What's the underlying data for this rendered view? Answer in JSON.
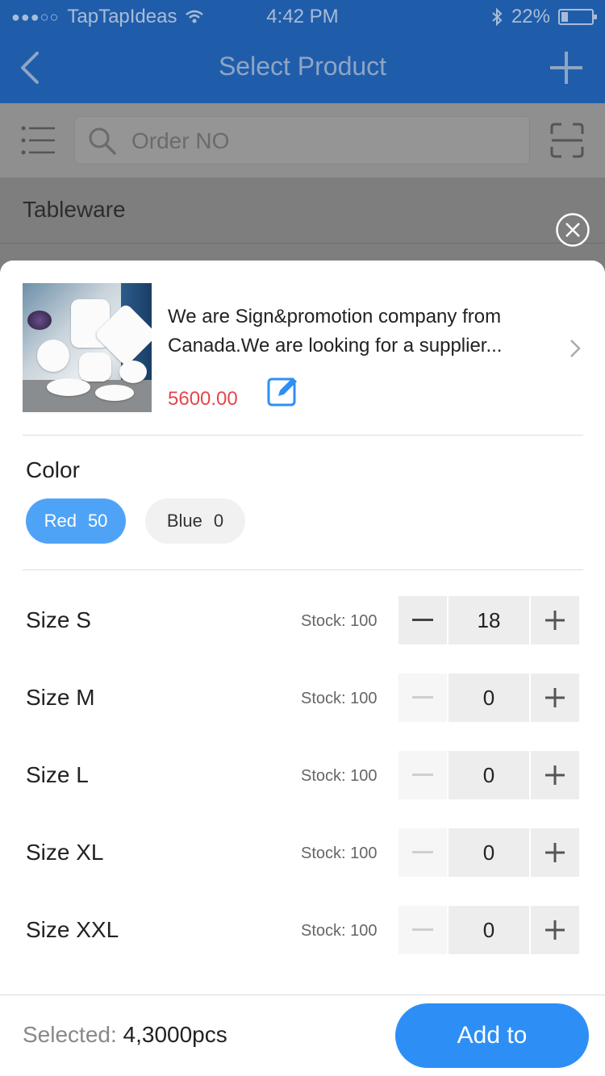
{
  "status_bar": {
    "carrier": "TapTapIdeas",
    "time": "4:42 PM",
    "battery": "22%",
    "battery_level": 0.22
  },
  "nav": {
    "title": "Select Product"
  },
  "search": {
    "placeholder": "Order NO"
  },
  "category": {
    "label": "Tableware"
  },
  "product": {
    "description": "We are Sign&promotion company from Canada.We are looking for a supplier...",
    "price": "5600.00"
  },
  "color_section": {
    "title": "Color",
    "options": [
      {
        "name": "Red",
        "count": "50",
        "selected": true
      },
      {
        "name": "Blue",
        "count": "0",
        "selected": false
      }
    ]
  },
  "sizes": [
    {
      "name": "Size S",
      "stock": "Stock: 100",
      "qty": "18"
    },
    {
      "name": "Size M",
      "stock": "Stock: 100",
      "qty": "0"
    },
    {
      "name": "Size L",
      "stock": "Stock: 100",
      "qty": "0"
    },
    {
      "name": "Size XL",
      "stock": "Stock: 100",
      "qty": "0"
    },
    {
      "name": "Size XXL",
      "stock": "Stock: 100",
      "qty": "0"
    }
  ],
  "footer": {
    "selected_label": "Selected:",
    "selected_value": "4,3000",
    "unit": "pcs",
    "add_label": "Add to"
  },
  "colors": {
    "nav_blue": "#1f5dab",
    "accent_blue": "#2d8ff5",
    "chip_blue": "#4fa3f7",
    "price_red": "#e6464b"
  }
}
